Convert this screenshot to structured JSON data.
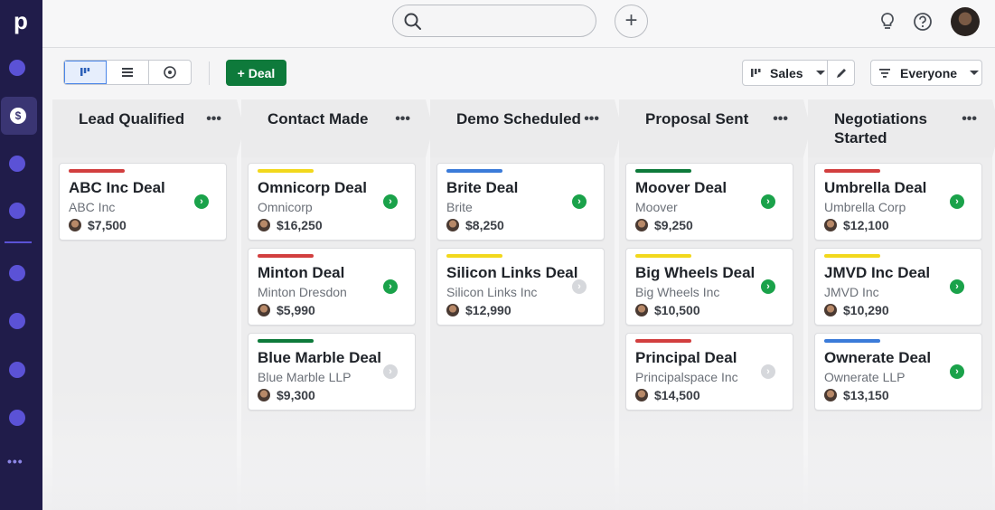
{
  "rail": {
    "logo": "p",
    "more": "•••"
  },
  "topbar": {
    "add_symbol": "+"
  },
  "toolbar": {
    "add_deal_label": "+ Deal",
    "pipeline": "Sales",
    "filter": "Everyone"
  },
  "stages": [
    {
      "title": "Lead Qualified",
      "menu": "•••",
      "deals": [
        {
          "title": "ABC Inc Deal",
          "org": "ABC Inc",
          "value": "$7,500",
          "label_color": "#d23f3f",
          "status": "green"
        }
      ]
    },
    {
      "title": "Contact Made",
      "menu": "•••",
      "deals": [
        {
          "title": "Omnicorp Deal",
          "org": "Omnicorp",
          "value": "$16,250",
          "label_color": "#f2d81c",
          "status": "green"
        },
        {
          "title": "Minton Deal",
          "org": "Minton Dresdon",
          "value": "$5,990",
          "label_color": "#d23f3f",
          "status": "green"
        },
        {
          "title": "Blue Marble Deal",
          "org": "Blue Marble LLP",
          "value": "$9,300",
          "label_color": "#0e7a3b",
          "status": "grey"
        }
      ]
    },
    {
      "title": "Demo Scheduled",
      "menu": "•••",
      "deals": [
        {
          "title": "Brite Deal",
          "org": "Brite",
          "value": "$8,250",
          "label_color": "#3b7bd9",
          "status": "green"
        },
        {
          "title": "Silicon Links Deal",
          "org": "Silicon Links Inc",
          "value": "$12,990",
          "label_color": "#f2d81c",
          "status": "grey"
        }
      ]
    },
    {
      "title": "Proposal Sent",
      "menu": "•••",
      "deals": [
        {
          "title": "Moover Deal",
          "org": "Moover",
          "value": "$9,250",
          "label_color": "#0e7a3b",
          "status": "green"
        },
        {
          "title": "Big Wheels Deal",
          "org": "Big Wheels Inc",
          "value": "$10,500",
          "label_color": "#f2d81c",
          "status": "green"
        },
        {
          "title": "Principal Deal",
          "org": "Principalspace Inc",
          "value": "$14,500",
          "label_color": "#d23f3f",
          "status": "grey"
        }
      ]
    },
    {
      "title": "Negotiations Started",
      "menu": "•••",
      "deals": [
        {
          "title": "Umbrella Deal",
          "org": "Umbrella Corp",
          "value": "$12,100",
          "label_color": "#d23f3f",
          "status": "green"
        },
        {
          "title": "JMVD Inc Deal",
          "org": "JMVD Inc",
          "value": "$10,290",
          "label_color": "#f2d81c",
          "status": "green"
        },
        {
          "title": "Ownerate Deal",
          "org": "Ownerate LLP",
          "value": "$13,150",
          "label_color": "#3b7bd9",
          "status": "green"
        }
      ]
    }
  ]
}
